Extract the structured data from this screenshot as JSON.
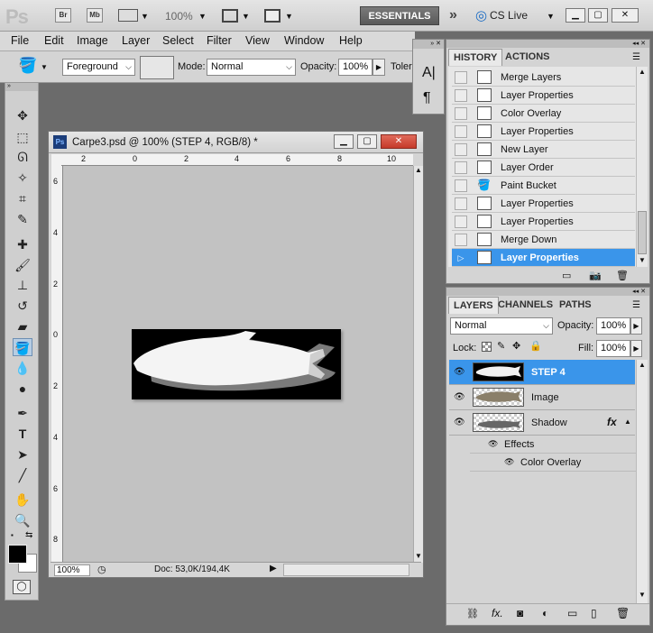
{
  "appbar": {
    "logo": "Ps",
    "bridge": "Br",
    "minibridge": "Mb",
    "zoom": "100%",
    "workspace": "ESSENTIALS",
    "cslive": "CS Live"
  },
  "menu": [
    "File",
    "Edit",
    "Image",
    "Layer",
    "Select",
    "Filter",
    "View",
    "Window",
    "Help"
  ],
  "options": {
    "fill_source": "Foreground",
    "mode_label": "Mode:",
    "mode_value": "Normal",
    "opacity_label": "Opacity:",
    "opacity_value": "100%",
    "tolerance_label": "Toler"
  },
  "document": {
    "ps_badge": "Ps",
    "title": "Carpe3.psd @ 100% (STEP 4, RGB/8) *",
    "hruler": [
      "2",
      "0",
      "2",
      "4",
      "6",
      "8",
      "10"
    ],
    "vruler": [
      "6",
      "4",
      "2",
      "0",
      "2",
      "4",
      "6",
      "8"
    ],
    "zoom": "100%",
    "doc_info": "Doc: 53,0K/194,4K"
  },
  "history": {
    "tabs": [
      "HISTORY",
      "ACTIONS"
    ],
    "items": [
      "Merge Layers",
      "Layer Properties",
      "Color Overlay",
      "Layer Properties",
      "New Layer",
      "Layer Order",
      "Paint Bucket",
      "Layer Properties",
      "Layer Properties",
      "Merge Down",
      "Layer Properties"
    ]
  },
  "layers": {
    "tabs": [
      "LAYERS",
      "CHANNELS",
      "PATHS"
    ],
    "blend_mode": "Normal",
    "opacity_label": "Opacity:",
    "opacity_value": "100%",
    "lock_label": "Lock:",
    "fill_label": "Fill:",
    "fill_value": "100%",
    "items": [
      "STEP 4",
      "Image",
      "Shadow"
    ],
    "effects_label": "Effects",
    "effect_item": "Color Overlay",
    "fx": "fx"
  },
  "colors": {
    "selection": "#3a95ea",
    "panel": "#d4d4d4",
    "workspace": "#6b6b6b"
  }
}
